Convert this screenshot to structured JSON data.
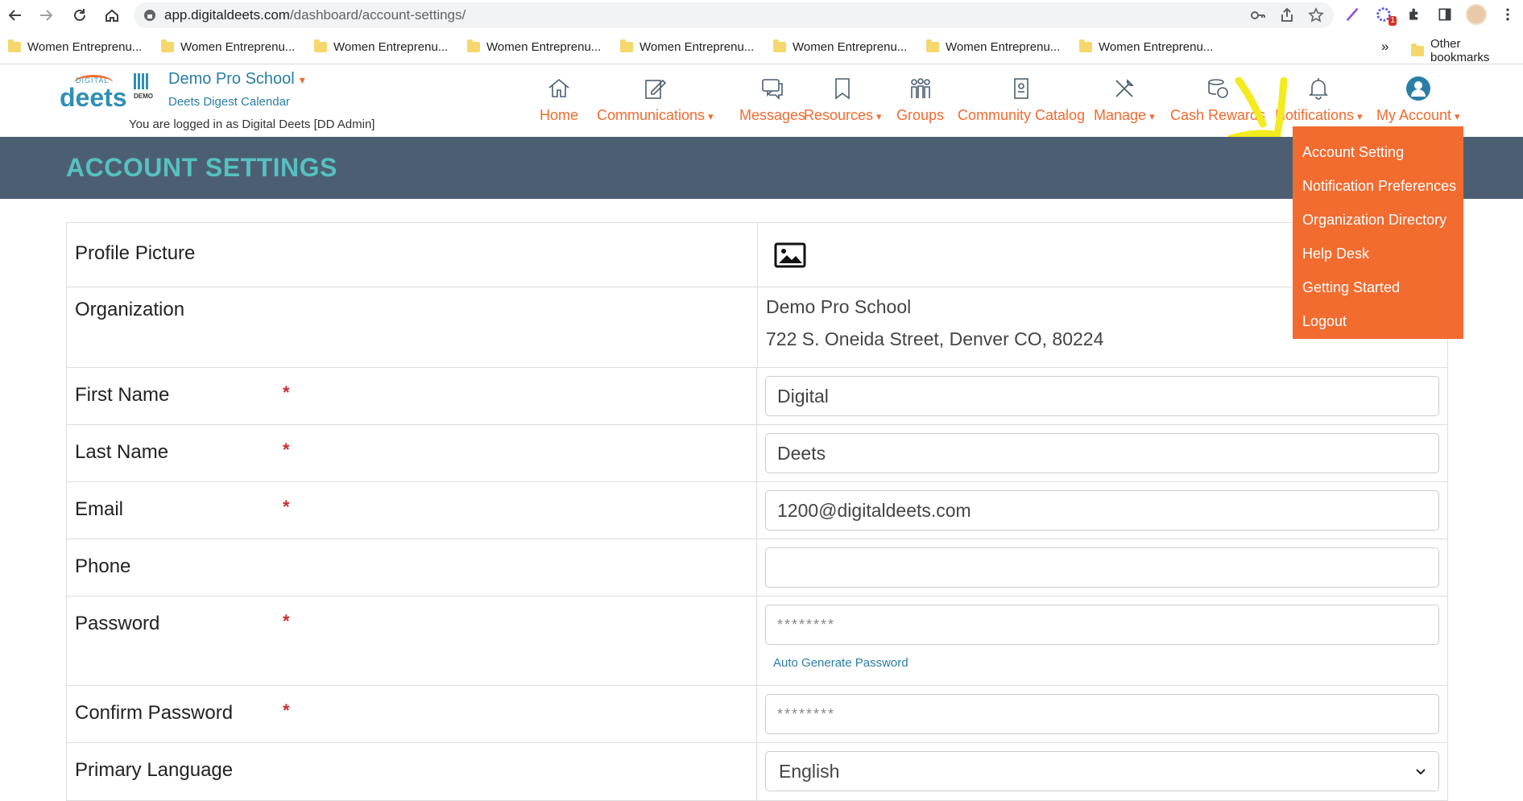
{
  "browser": {
    "url_host": "app.digitaldeets.com",
    "url_path": "/dashboard/account-settings/",
    "bookmarks": [
      {
        "label": "Women Entreprenu..."
      },
      {
        "label": "Women Entreprenu..."
      },
      {
        "label": "Women Entreprenu..."
      },
      {
        "label": "Women Entreprenu..."
      },
      {
        "label": "Women Entreprenu..."
      },
      {
        "label": "Women Entreprenu..."
      },
      {
        "label": "Women Entreprenu..."
      },
      {
        "label": "Women Entreprenu..."
      }
    ],
    "bookmarks_more": "»",
    "other_bookmarks": "Other bookmarks",
    "extension_badge": "1"
  },
  "header": {
    "logo_small": "DIGITAL",
    "logo_text": "deets",
    "school_logo_text": "DEMO",
    "school_name": "Demo Pro School",
    "digest_link": "Deets Digest Calendar",
    "logged_in_text": "You are logged in as Digital Deets [DD Admin]",
    "caret": "▾"
  },
  "nav": {
    "home": "Home",
    "communications": "Communications",
    "messages": "Messages",
    "resources": "Resources",
    "groups": "Groups",
    "community_catalog": "Community Catalog",
    "manage": "Manage",
    "cash_rewards": "Cash Rewards",
    "notifications": "Notifications",
    "my_account": "My Account"
  },
  "page_title": "ACCOUNT SETTINGS",
  "dropdown": {
    "items": [
      {
        "label": "Account Setting"
      },
      {
        "label": "Notification Preferences"
      },
      {
        "label": "Organization Directory"
      },
      {
        "label": "Help Desk"
      },
      {
        "label": "Getting Started"
      },
      {
        "label": "Logout"
      }
    ]
  },
  "form": {
    "required_mark": "*",
    "profile_picture_label": "Profile Picture",
    "organization_label": "Organization",
    "org_name": "Demo Pro School",
    "org_address": "722 S. Oneida Street, Denver CO, 80224",
    "first_name_label": "First Name",
    "first_name_value": "Digital",
    "last_name_label": "Last Name",
    "last_name_value": "Deets",
    "email_label": "Email",
    "email_value": "1200@digitaldeets.com",
    "phone_label": "Phone",
    "phone_value": "",
    "password_label": "Password",
    "password_value": "********",
    "auto_generate": "Auto Generate Password",
    "confirm_password_label": "Confirm Password",
    "confirm_password_value": "********",
    "language_label": "Primary Language",
    "language_value": "English"
  },
  "colors": {
    "accent_orange": "#f26b2f",
    "title_bar": "#4c5f72",
    "title_text": "#56c1c0",
    "link_blue": "#2a7ea5"
  }
}
